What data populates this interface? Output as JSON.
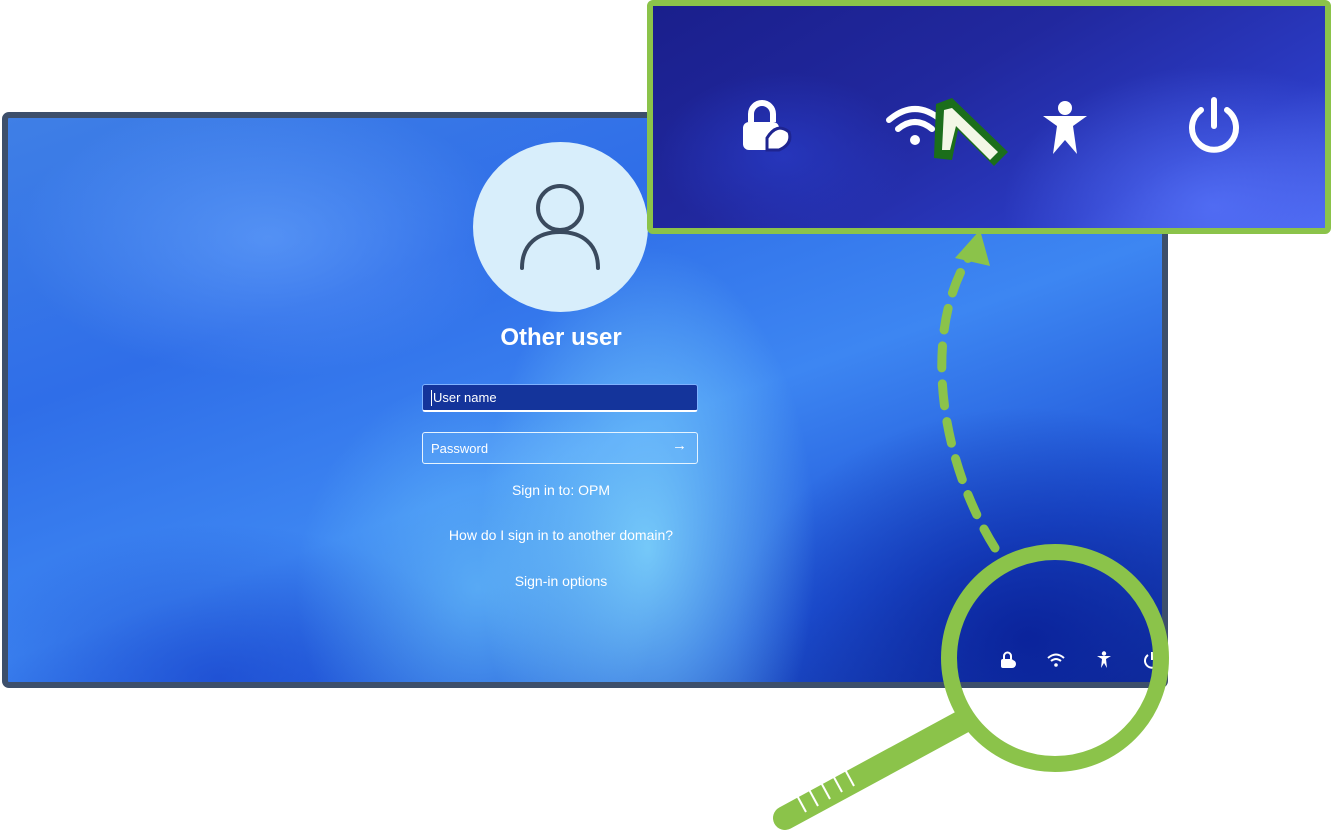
{
  "login": {
    "user_title": "Other user",
    "username_placeholder": "User name",
    "password_placeholder": "Password",
    "submit_arrow": "→",
    "sign_in_to": "Sign in to: OPM",
    "domain_help": "How do I sign in to another domain?",
    "sign_in_options": "Sign-in options"
  },
  "corner_icons": [
    "accessibility-lock-icon",
    "wifi-icon",
    "accessibility-icon",
    "power-icon"
  ],
  "zoom_inset": {
    "icons": [
      "accessibility-lock-icon",
      "wifi-icon",
      "accessibility-icon",
      "power-icon"
    ],
    "highlighted": "wifi-icon"
  },
  "colors": {
    "highlight_green": "#8bc34a",
    "arrow_dark_green": "#1b6e1b",
    "frame": "#3d4f6b"
  }
}
